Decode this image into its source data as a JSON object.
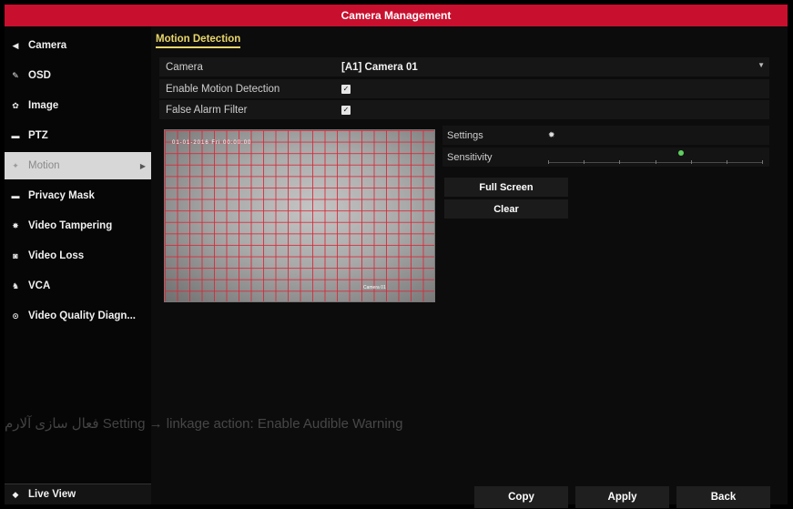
{
  "window": {
    "title": "Camera Management"
  },
  "sidebar": {
    "items": [
      {
        "label": "Camera",
        "icon": "camera-icon"
      },
      {
        "label": "OSD",
        "icon": "brush-icon"
      },
      {
        "label": "Image",
        "icon": "palette-icon"
      },
      {
        "label": "PTZ",
        "icon": "ptz-icon"
      },
      {
        "label": "Motion",
        "icon": "motion-icon",
        "active": true
      },
      {
        "label": "Privacy Mask",
        "icon": "mask-icon"
      },
      {
        "label": "Video Tampering",
        "icon": "tamper-icon"
      },
      {
        "label": "Video Loss",
        "icon": "video-loss-icon"
      },
      {
        "label": "VCA",
        "icon": "vca-icon"
      },
      {
        "label": "Video Quality Diagn...",
        "icon": "diagnostic-icon"
      }
    ],
    "live_view": "Live View"
  },
  "main": {
    "tab": "Motion Detection",
    "camera_label": "Camera",
    "camera_value": "[A1] Camera 01",
    "enable_label": "Enable Motion Detection",
    "enable_checked": true,
    "false_alarm_label": "False Alarm Filter",
    "false_alarm_checked": true,
    "settings_label": "Settings",
    "sensitivity_label": "Sensitivity",
    "sensitivity_level": 0.62,
    "full_screen_label": "Full Screen",
    "clear_label": "Clear",
    "osd_top": "01-01-2016 Fri 00:00:00",
    "osd_bottom": "Camera 01"
  },
  "overlay_note": "فعال سازی آلارم Setting → linkage action: Enable Audible Warning",
  "footer": {
    "copy": "Copy",
    "apply": "Apply",
    "back": "Back"
  },
  "colors": {
    "title_bar": "#c8102e",
    "tab_accent": "#e8d66a",
    "grid_line": "#d72837",
    "knob": "#5fcf5f"
  }
}
